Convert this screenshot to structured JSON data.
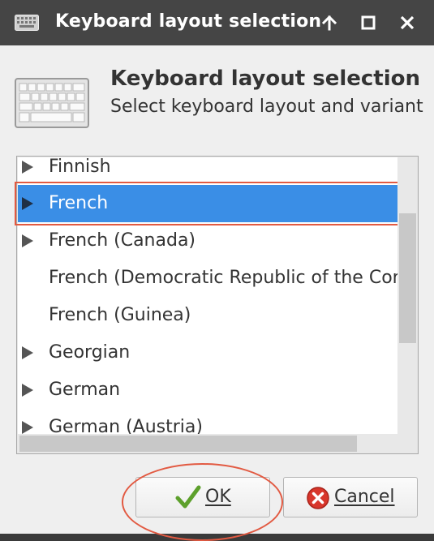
{
  "window": {
    "title": "Keyboard layout selection",
    "controls": [
      "up-arrow-icon",
      "maximize-icon",
      "close-icon"
    ]
  },
  "header": {
    "icon": "keyboard-icon",
    "title": "Keyboard layout selection",
    "subtitle": "Select keyboard layout and variant"
  },
  "layouts": [
    {
      "label": "Finnish",
      "expandable": true,
      "selected": false
    },
    {
      "label": "French",
      "expandable": true,
      "selected": true
    },
    {
      "label": "French (Canada)",
      "expandable": true,
      "selected": false
    },
    {
      "label": "French (Democratic Republic of the Congo)",
      "expandable": false,
      "selected": false
    },
    {
      "label": "French (Guinea)",
      "expandable": false,
      "selected": false
    },
    {
      "label": "Georgian",
      "expandable": true,
      "selected": false
    },
    {
      "label": "German",
      "expandable": true,
      "selected": false
    },
    {
      "label": "German (Austria)",
      "expandable": true,
      "selected": false
    }
  ],
  "buttons": {
    "ok": "OK",
    "cancel": "Cancel"
  },
  "colors": {
    "titlebar": "#454545",
    "selection": "#3a8ee6",
    "annotation": "#e25a42"
  }
}
